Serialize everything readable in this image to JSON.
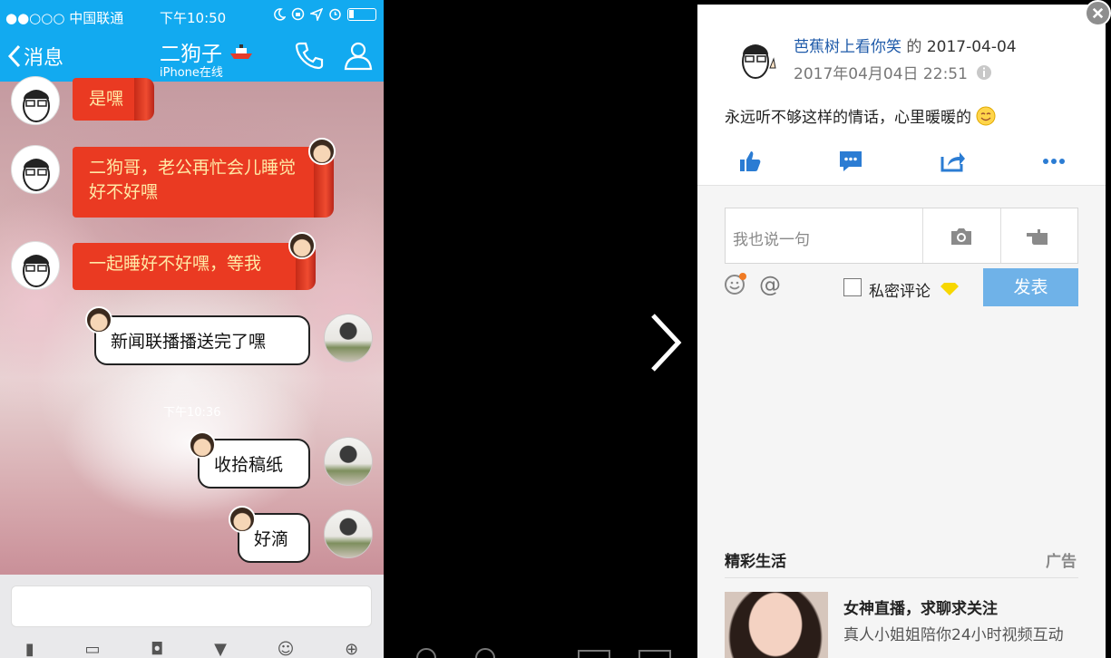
{
  "phone": {
    "status": {
      "carrier": "●●○○○ 中国联通",
      "time": "下午10:50"
    },
    "nav": {
      "back_label": "消息",
      "contact_name": "二狗子",
      "contact_status": "iPhone在线"
    },
    "messages_in": [
      {
        "text": "是嘿"
      },
      {
        "text": "二狗哥，老公再忙会儿睡觉好不好嘿"
      },
      {
        "text": "一起睡好不好嘿，等我"
      }
    ],
    "messages_out": [
      {
        "text": "新闻联播播送完了嘿"
      },
      {
        "text": "收拾稿纸"
      },
      {
        "text": "好滴"
      }
    ],
    "time_divider": "下午10:36"
  },
  "post": {
    "author": "芭蕉树上看你笑",
    "connector": "的",
    "date": "2017-04-04",
    "timestamp": "2017年04月04日 22:51",
    "text": "永远听不够这样的情话，心里暖暖的",
    "actions": [
      "like-icon",
      "comment-icon",
      "share-icon",
      "more-icon"
    ]
  },
  "comment": {
    "placeholder": "我也说一句",
    "private_label": "私密评论",
    "submit_label": "发表"
  },
  "ad": {
    "section_title": "精彩生活",
    "tag": "广告",
    "title": "女神直播，求聊求关注",
    "description": "真人小姐姐陪你24小时视频互动"
  },
  "colors": {
    "qq_blue": "#12aaf0",
    "link_blue": "#1e5aa9",
    "action_blue": "#2b7cd3",
    "submit_blue": "#6fb2e8",
    "bubble_red": "#ea3a22"
  }
}
